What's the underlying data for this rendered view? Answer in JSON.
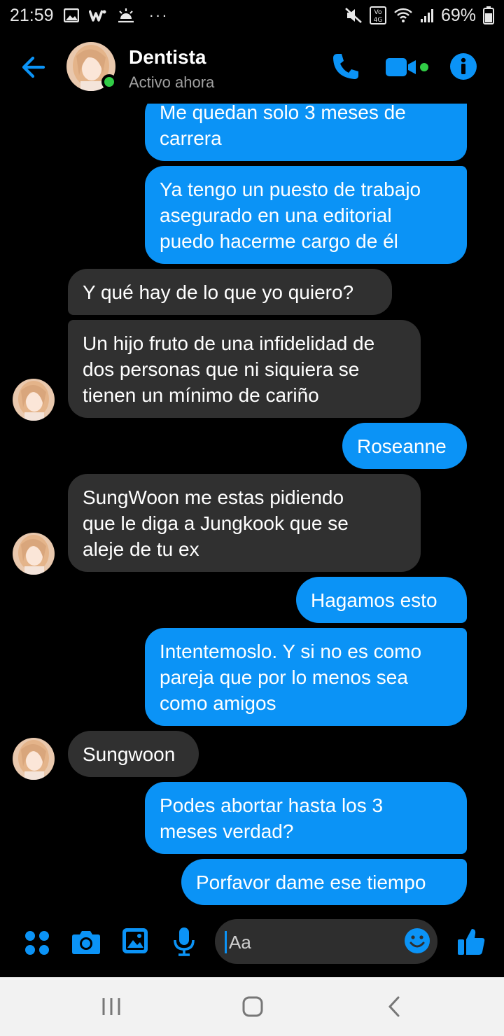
{
  "status_bar": {
    "time": "21:59",
    "more": "···",
    "battery": "69%",
    "network_badge": "Vo 4G"
  },
  "header": {
    "contact_name": "Dentista",
    "contact_status": "Activo ahora",
    "accent_color": "#0b93f6",
    "online_color": "#31cc46"
  },
  "messages": [
    {
      "side": "out",
      "lines": [
        "Me quedan solo 3 meses de",
        "carrera"
      ]
    },
    {
      "side": "out",
      "lines": [
        "Ya tengo un puesto de trabajo",
        "asegurado en una editorial",
        "puedo hacerme cargo de él"
      ]
    },
    {
      "side": "in",
      "lines": [
        "Y qué hay de lo que yo quiero?"
      ]
    },
    {
      "side": "in",
      "lines": [
        "Un hijo fruto de una infidelidad de",
        "dos personas que ni siquiera se",
        "tienen un mínimo de cariño"
      ]
    },
    {
      "side": "out",
      "lines": [
        "Roseanne"
      ]
    },
    {
      "side": "in",
      "lines": [
        "SungWoon me estas pidiendo",
        "que le diga a Jungkook que se",
        "aleje de tu ex"
      ]
    },
    {
      "side": "out",
      "lines": [
        "Hagamos esto"
      ]
    },
    {
      "side": "out",
      "lines": [
        "Intentemoslo. Y si no es como",
        "pareja que por lo menos sea",
        "como amigos"
      ]
    },
    {
      "side": "in",
      "lines": [
        "Sungwoon"
      ]
    },
    {
      "side": "out",
      "lines": [
        "Podes abortar hasta los 3",
        "meses verdad?"
      ]
    },
    {
      "side": "out",
      "lines": [
        "Porfavor dame ese tiempo"
      ]
    }
  ],
  "composer": {
    "placeholder": "Aa"
  },
  "icons": {
    "back": "arrow-left-icon",
    "call": "phone-icon",
    "video": "video-camera-icon",
    "info": "info-icon",
    "menu": "four-dots-icon",
    "camera": "camera-icon",
    "gallery": "image-icon",
    "mic": "microphone-icon",
    "emoji": "smiley-icon",
    "like": "thumbs-up-icon"
  }
}
